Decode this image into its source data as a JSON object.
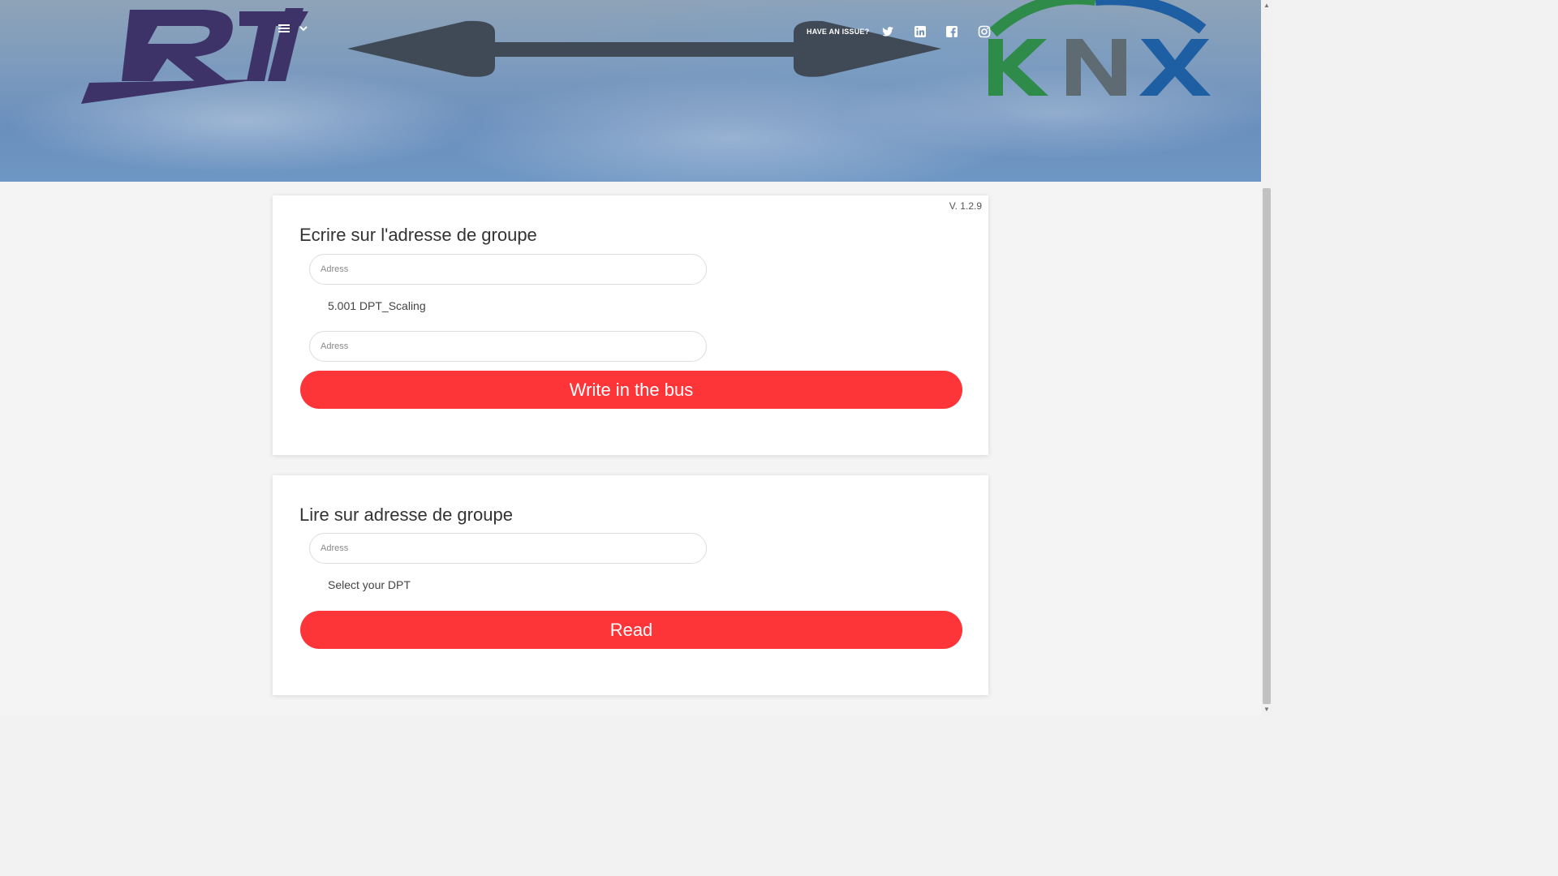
{
  "header": {
    "logo_left": "RTI",
    "logo_right": "KNX",
    "issue_link": "HAVE AN ISSUE?",
    "social_icons": [
      "twitter-icon",
      "linkedin-icon",
      "facebook-icon",
      "instagram-icon"
    ]
  },
  "write_card": {
    "version": "V. 1.2.9",
    "title": "Ecrire sur l'adresse de groupe",
    "address_placeholder": "Adress",
    "dpt_label": "5.001 DPT_Scaling",
    "value_placeholder": "Adress",
    "button_label": "Write in the bus"
  },
  "read_card": {
    "title": "Lire sur adresse de groupe",
    "address_placeholder": "Adress",
    "dpt_label": "Select your DPT",
    "button_label": "Read"
  },
  "colors": {
    "accent": "#fd3438",
    "rti_purple": "#3d3369",
    "knx_green": "#2e8b4a",
    "knx_grey": "#5f6b73",
    "knx_blue": "#1e5fa3"
  }
}
